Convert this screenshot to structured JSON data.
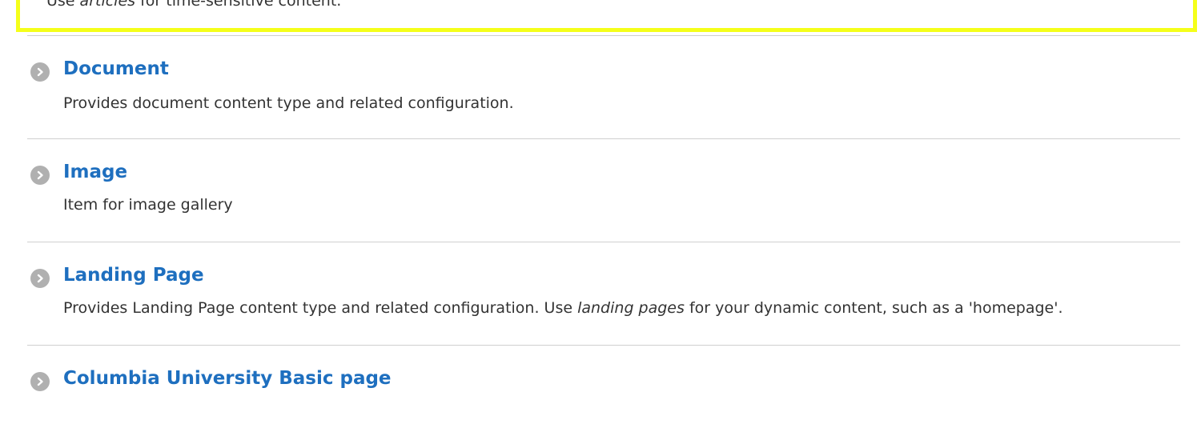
{
  "highlighted_item": {
    "desc_prefix": "Use ",
    "desc_emph": "articles",
    "desc_suffix": " for time-sensitive content."
  },
  "content_types": [
    {
      "title": "Document",
      "description": "Provides document content type and related configuration."
    },
    {
      "title": "Image",
      "description": "Item for image gallery"
    },
    {
      "title": "Landing Page",
      "desc_prefix": "Provides Landing Page content type and related configuration. Use ",
      "desc_emph": "landing pages",
      "desc_suffix": " for your dynamic content, such as a 'homepage'."
    },
    {
      "title": "Columbia University Basic page"
    }
  ],
  "colors": {
    "highlight": "#f5ff1a",
    "link": "#1e6fbf",
    "arrow": "#b0b0b0"
  },
  "icons": {
    "item_arrow": "chevron-right-circle-icon"
  }
}
